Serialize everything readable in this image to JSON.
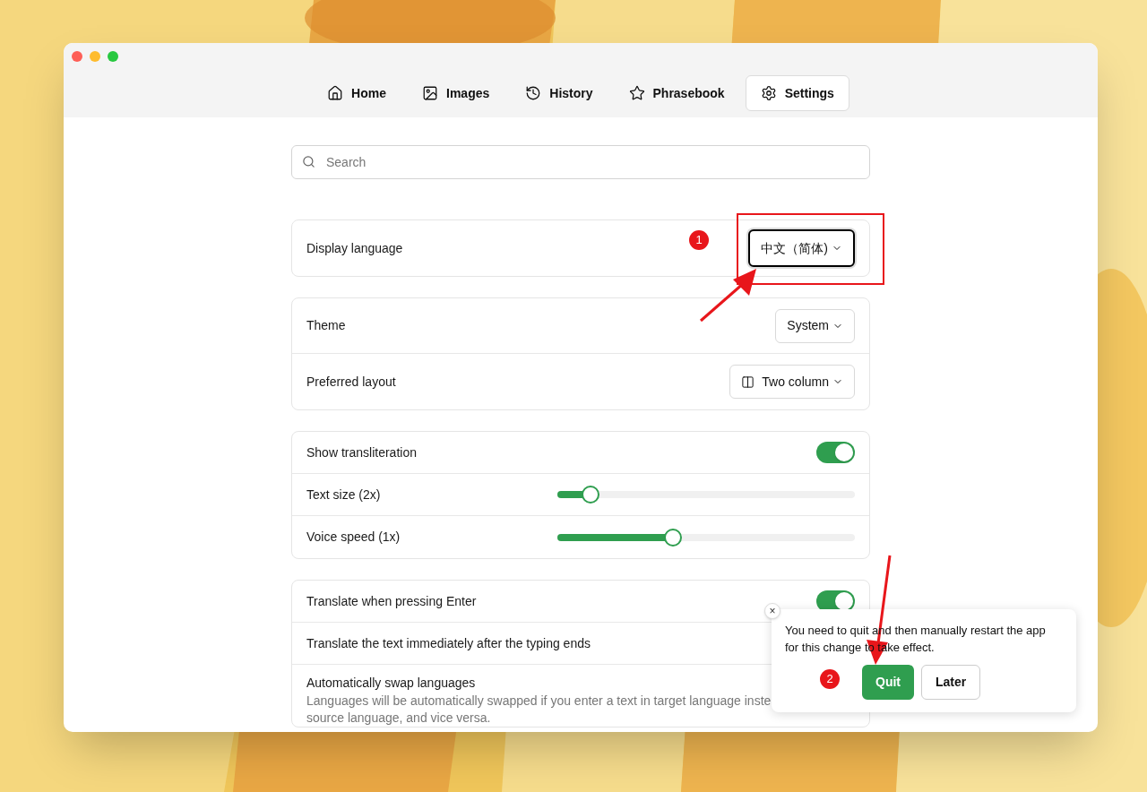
{
  "tabs": [
    {
      "label": "Home",
      "selected": false
    },
    {
      "label": "Images",
      "selected": false
    },
    {
      "label": "History",
      "selected": false
    },
    {
      "label": "Phrasebook",
      "selected": false
    },
    {
      "label": "Settings",
      "selected": true
    }
  ],
  "search": {
    "placeholder": "Search"
  },
  "groups": [
    {
      "rows": [
        {
          "kind": "select",
          "label": "Display language",
          "value": "中文（简体)",
          "focused": true
        }
      ]
    },
    {
      "rows": [
        {
          "kind": "select",
          "label": "Theme",
          "value": "System",
          "focused": false
        },
        {
          "kind": "select",
          "label": "Preferred layout",
          "value": "Two column",
          "focused": false
        }
      ]
    },
    {
      "rows": [
        {
          "kind": "toggle",
          "label": "Show transliteration",
          "on": true
        },
        {
          "kind": "slider",
          "label": "Text size (2x)",
          "level": 0.11
        },
        {
          "kind": "slider",
          "label": "Voice speed (1x)",
          "level": 0.39
        }
      ]
    },
    {
      "rows": [
        {
          "kind": "toggle",
          "label": "Translate when pressing Enter",
          "on": true
        },
        {
          "kind": "plain",
          "label": "Translate the text immediately after the typing ends"
        },
        {
          "kind": "plain",
          "label": "Automatically swap languages",
          "description_lines": [
            "Languages will be automatically swapped if you enter a text in target language inste",
            "source language, and vice versa."
          ]
        }
      ]
    }
  ],
  "popover": {
    "close": "×",
    "message": "You need to quit and then manually restart the app for this change to take effect.",
    "buttons": [
      {
        "label": "Quit",
        "primary": true
      },
      {
        "label": "Later",
        "primary": false
      }
    ]
  },
  "annotations": [
    {
      "kind": "badge",
      "text": "1"
    },
    {
      "kind": "badge",
      "text": "2"
    }
  ]
}
